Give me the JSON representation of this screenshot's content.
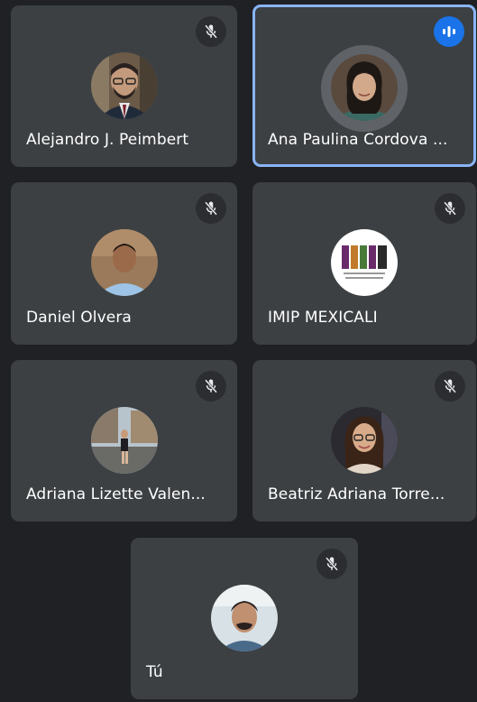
{
  "participants": [
    {
      "name": "Alejandro J. Peimbert",
      "muted": true,
      "speaking": false,
      "mic_icon": "mic-off-icon"
    },
    {
      "name": "Ana Paulina Cordova ...",
      "muted": false,
      "speaking": true,
      "mic_icon": "audio-level-icon"
    },
    {
      "name": "Daniel Olvera",
      "muted": true,
      "speaking": false,
      "mic_icon": "mic-off-icon"
    },
    {
      "name": "IMIP MEXICALI",
      "muted": true,
      "speaking": false,
      "mic_icon": "mic-off-icon"
    },
    {
      "name": "Adriana Lizette Valen...",
      "muted": true,
      "speaking": false,
      "mic_icon": "mic-off-icon"
    },
    {
      "name": "Beatriz Adriana Torre...",
      "muted": true,
      "speaking": false,
      "mic_icon": "mic-off-icon"
    },
    {
      "name": "Tú",
      "muted": true,
      "speaking": false,
      "mic_icon": "mic-off-icon"
    }
  ],
  "colors": {
    "background": "#202124",
    "tile": "#3c4043",
    "speaking_border": "#8ab4f8",
    "audio_badge": "#1a73e8"
  }
}
